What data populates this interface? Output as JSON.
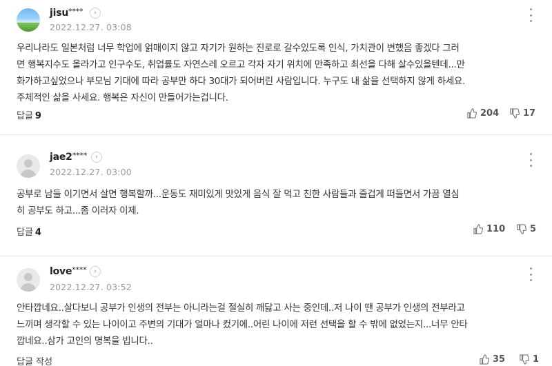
{
  "comments": [
    {
      "username": "jisu",
      "mask": "****",
      "date": "2022.12.27. 03:08",
      "avatar": "photo",
      "lines": [
        "우리나라도 일본처럼 너무 학업에 얽매이지 않고 자기가 원하는 진로로 갈수있도록 인식, 가치관이 변했음 좋겠다 그러",
        "면 행복지수도 올라가고 인구수도, 취업률도 자연스레 오르고 각자 자기 위치에 만족하고 최선을 다해 살수있을텐데...만",
        "화가하고싶었으나 부모님 기대에 따라 공부만 하다 30대가 되어버린 사람입니다. 누구도 내 삶을 선택하지 않게 하세요.",
        "주체적인 삶을 사세요. 행복은 자신이 만들어가는겁니다."
      ],
      "reply_label": "답글",
      "reply_count": "9",
      "likes": "204",
      "dislikes": "17"
    },
    {
      "username": "jae2",
      "mask": "****",
      "date": "2022.12.27. 03:00",
      "avatar": "default",
      "lines": [
        "공부로 남들 이기면서 살면 행복할까...운동도 재미있게 맛있게 음식 잘 먹고 친한 사람들과 즐겁게 떠들면서 가끔 열심",
        "히 공부도 하고...좀 이러자 이제."
      ],
      "reply_label": "답글",
      "reply_count": "4",
      "likes": "110",
      "dislikes": "5"
    },
    {
      "username": "love",
      "mask": "****",
      "date": "2022.12.27. 03:52",
      "avatar": "default",
      "lines": [
        "안타깝네요..살다보니 공부가 인생의 전부는 아니라는걸 절실히 깨닳고 사는 중인데..저 나이 땐 공부가 인생의 전부라고",
        "느끼며 생각할 수 있는 나이이고 주변의 기대가 얼마나 컸기에..어린 나이에 저런 선택을 할 수 밖에 없었는지...너무 안타",
        "깝네요..삼가 고인의 명복을 빕니다.."
      ],
      "reply_label": "답글 작성",
      "reply_count": "",
      "likes": "35",
      "dislikes": "1"
    }
  ],
  "icons": {
    "profile": "chevron-right-icon",
    "more": "more-vertical-icon",
    "like": "thumbs-up-icon",
    "dislike": "thumbs-down-icon"
  },
  "colors": {
    "text": "#333333",
    "muted": "#999999",
    "divider": "#e6e6e6"
  }
}
